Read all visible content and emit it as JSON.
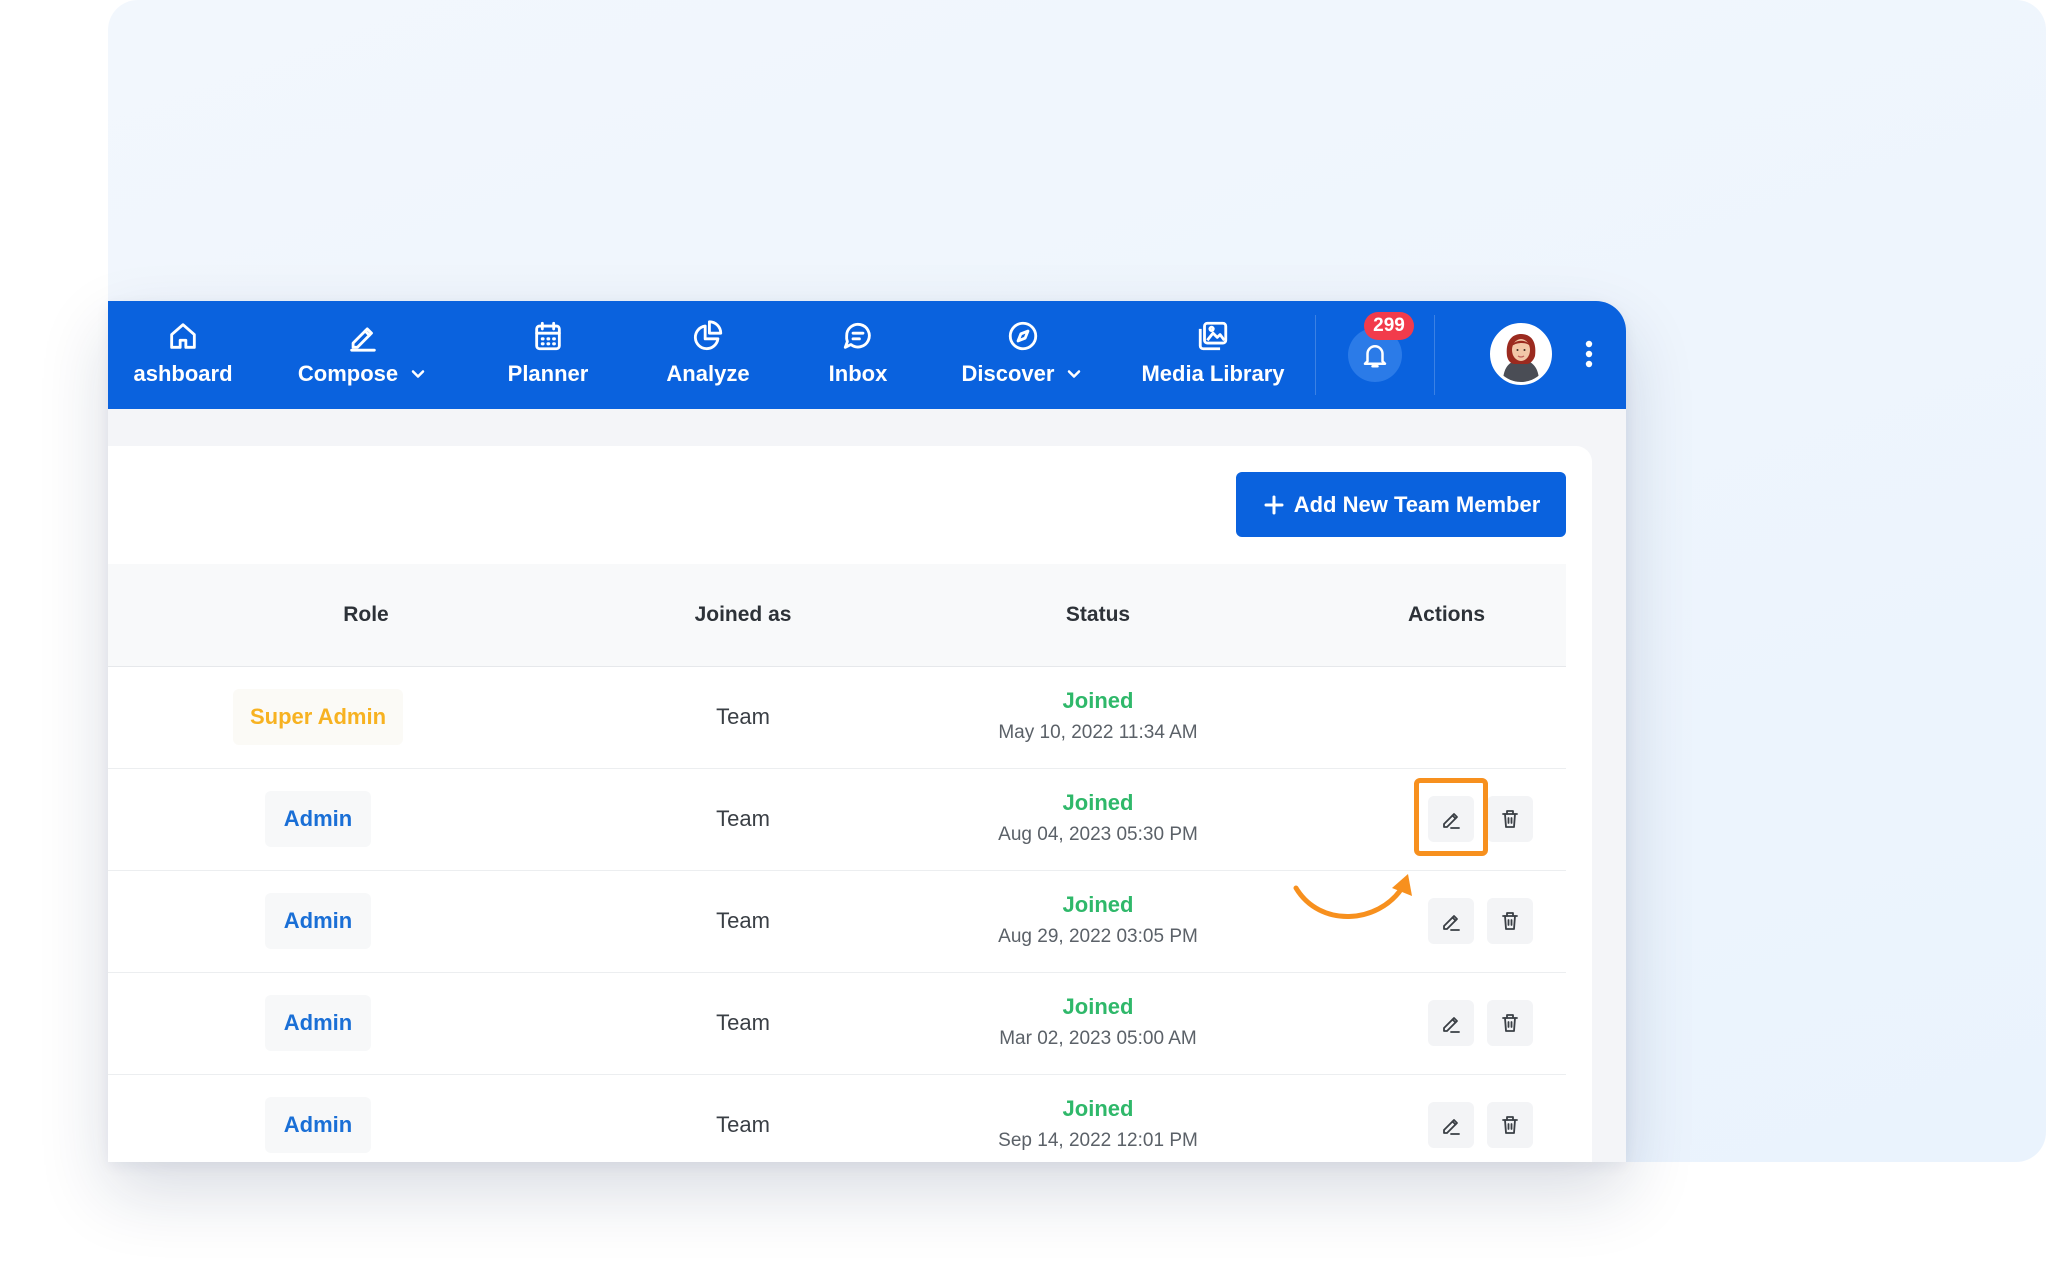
{
  "nav": {
    "items": [
      {
        "label": "ashboard",
        "icon": "home-icon"
      },
      {
        "label": "Compose",
        "icon": "pen-icon",
        "dropdown": true
      },
      {
        "label": "Planner",
        "icon": "calendar-icon"
      },
      {
        "label": "Analyze",
        "icon": "pie-chart-icon"
      },
      {
        "label": "Inbox",
        "icon": "chat-bubble-icon"
      },
      {
        "label": "Discover",
        "icon": "compass-icon",
        "dropdown": true
      },
      {
        "label": "Media Library",
        "icon": "image-gallery-icon"
      }
    ],
    "notifications_count": "299"
  },
  "team": {
    "add_button_label": "Add New Team Member",
    "columns": {
      "role": "Role",
      "joined_as": "Joined as",
      "status": "Status",
      "actions": "Actions"
    },
    "rows": [
      {
        "role": "Super Admin",
        "joined_as": "Team",
        "status": "Joined",
        "date": "May 10, 2022 11:34 AM",
        "actions": false
      },
      {
        "role": "Admin",
        "joined_as": "Team",
        "status": "Joined",
        "date": "Aug 04, 2023 05:30 PM",
        "actions": true
      },
      {
        "role": "Admin",
        "joined_as": "Team",
        "status": "Joined",
        "date": "Aug 29, 2022 03:05 PM",
        "actions": true
      },
      {
        "role": "Admin",
        "joined_as": "Team",
        "status": "Joined",
        "date": "Mar 02, 2023 05:00 AM",
        "actions": true
      },
      {
        "role": "Admin",
        "joined_as": "Team",
        "status": "Joined",
        "date": "Sep 14, 2022 12:01 PM",
        "actions": true
      }
    ]
  },
  "colors": {
    "brand_blue": "#0a62de",
    "super_admin": "#f7b221",
    "admin": "#1a6fd6",
    "joined": "#2fb86a",
    "highlight": "#f7901e",
    "badge": "#f23b4b"
  }
}
